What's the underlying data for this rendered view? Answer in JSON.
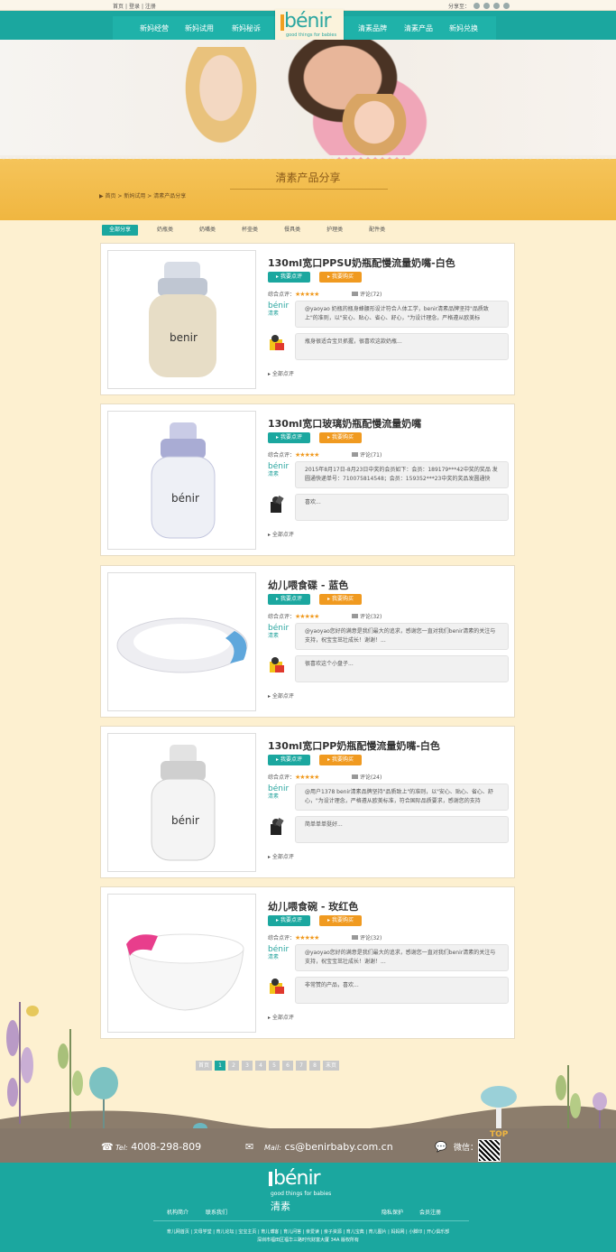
{
  "topbar": {
    "home": "首页",
    "login": "登录",
    "register": "注册",
    "share": "分享至："
  },
  "nav": {
    "left": [
      "新妈经营",
      "新妈试用",
      "新妈秘诉"
    ],
    "right": [
      "清素品牌",
      "清素产品",
      "新妈兑换"
    ]
  },
  "logo": {
    "brand": "bénir",
    "tagline": "good things for babies",
    "cn": "清素"
  },
  "page": {
    "title": "清素产品分享",
    "breadcrumb": "▶ 首页 > 新妈试用 > 清素产品分享"
  },
  "tabs": [
    "全部分享",
    "奶瓶类",
    "奶嘴类",
    "杯壶类",
    "餐具类",
    "护理类",
    "配件类"
  ],
  "common": {
    "comment_btn": "▸ 我要点评",
    "buy_btn": "▸ 我要购买",
    "rating_label": "综合点评：",
    "stars": "★★★★★",
    "all_reviews": "▸ 全部点评",
    "avatar_logo": "bénir",
    "avatar_cn": "清素"
  },
  "products": [
    {
      "title": "130ml宽口PPSU奶瓶配慢流量奶嘴-白色",
      "reviews": "评论(72)",
      "c1": "@yaoyao 奶瓶的瓶身蜂腰形设计符合人体工学，benir清素品牌坚持\"品质致上\"的准则，以\"安心、贴心、省心、舒心，\"为设计理念，严格遵从欧美标",
      "c2": "瓶身很适合宝贝抓握，很喜欢这款奶瓶..."
    },
    {
      "title": "130ml宽口玻璃奶瓶配慢流量奶嘴",
      "reviews": "评论(71)",
      "c1": "2015年8月17日-8月23日中奖的会员如下：会员：189179***42中奖的奖品 发圆通快递单号：710075814548；会员：159352***23中奖的奖品发圆通快",
      "c2": "喜欢..."
    },
    {
      "title": "幼儿喂食碟 - 蓝色",
      "reviews": "评论(32)",
      "c1": "@yaoyao您好的满意是我们最大的追求，感谢您一直对我们benir清素的关注与支持，祝宝宝茁壮成长！谢谢！...",
      "c2": "很喜欢这个小盘子..."
    },
    {
      "title": "130ml宽口PP奶瓶配慢流量奶嘴-白色",
      "reviews": "评论(24)",
      "c1": "@用户1378 benir清素品牌坚持\"品质致上\"的准则，以\"安心、贴心、省心、舒心，\"为设计理念，严格遵从欧美标准，符合国际品质要求，感谢您的支持",
      "c2": "简单单单挺好..."
    },
    {
      "title": "幼儿喂食碗 - 玫红色",
      "reviews": "评论(32)",
      "c1": "@yaoyao您好的满意是我们最大的追求，感谢您一直对我们benir清素的关注与支持，祝宝宝茁壮成长！谢谢！...",
      "c2": "非常赞的产品，喜欢..."
    }
  ],
  "pager": {
    "first": "首页",
    "pages": [
      "1",
      "2",
      "3",
      "4",
      "5",
      "6",
      "7",
      "8"
    ],
    "last": "末页"
  },
  "contact": {
    "tel_label": "Tel:",
    "tel": "4008-298-809",
    "mail_label": "Mail:",
    "mail": "cs@benirbaby.com.cn",
    "wechat": "微信：",
    "top": "TOP"
  },
  "footer": {
    "about": "机构简介",
    "contact": "联系我们",
    "privacy": "隐私保护",
    "register": "会员注册",
    "links": "育儿网首页 | 文母学堂 | 育儿论坛 | 宝宝主页 | 育儿博客 | 育儿问答 | 亲爱读 | 亲子资源 | 育儿宝典 | 育儿图片 | 妈妈网 | 小脚印 | 开心俱乐部",
    "address": "深圳市福田区福华三路时代财富大厦 34A 版权所有"
  },
  "colors": {
    "teal": "#1ba79f",
    "orange": "#f09a20",
    "band": "#f5c45a",
    "bg": "#fdf0d0"
  }
}
